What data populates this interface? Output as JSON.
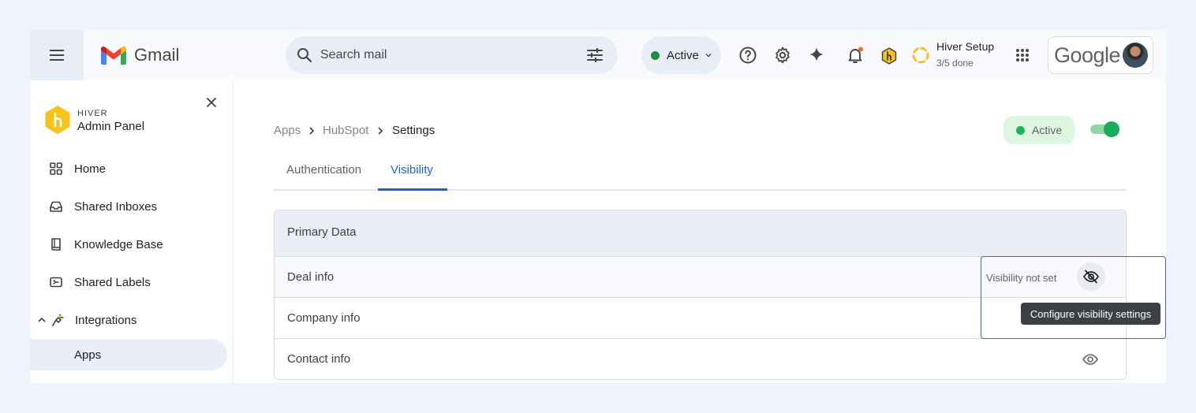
{
  "topbar": {
    "app_name": "Gmail",
    "search_placeholder": "Search mail",
    "status_label": "Active",
    "setup_title": "Hiver Setup",
    "setup_progress": "3/5 done",
    "account_brand": "Google"
  },
  "sidebar": {
    "brand_small": "HIVER",
    "brand_title": "Admin Panel",
    "items": [
      {
        "label": "Home",
        "icon": "grid-icon"
      },
      {
        "label": "Shared Inboxes",
        "icon": "inbox-icon"
      },
      {
        "label": "Knowledge Base",
        "icon": "book-icon"
      },
      {
        "label": "Shared Labels",
        "icon": "label-icon"
      },
      {
        "label": "Integrations",
        "icon": "plug-icon"
      },
      {
        "label": "Apps",
        "icon": ""
      }
    ]
  },
  "main": {
    "breadcrumb": [
      "Apps",
      "HubSpot",
      "Settings"
    ],
    "status_chip": "Active",
    "toggle_on": true,
    "tabs": [
      "Authentication",
      "Visibility"
    ],
    "active_tab": "Visibility",
    "table": {
      "header": "Primary Data",
      "rows": [
        {
          "name": "Deal info",
          "note": "Visibility not set"
        },
        {
          "name": "Company info",
          "note": ""
        },
        {
          "name": "Contact info",
          "note": ""
        }
      ]
    },
    "tooltip": "Configure visibility settings"
  },
  "colors": {
    "accent_blue": "#1a62d6",
    "active_green": "#1eb45a",
    "hiver_yellow": "#f6c21c"
  }
}
